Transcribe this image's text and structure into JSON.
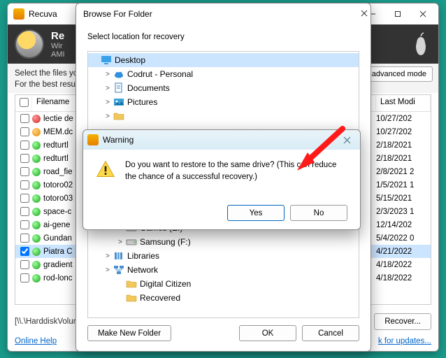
{
  "main": {
    "title": "Recuva",
    "heading_prefix": "Re",
    "sub1": "Wir",
    "sub2": "AMI",
    "instructions1": "Select the files you",
    "instructions2": "For the best results",
    "switch_mode": "to advanced mode",
    "path": "[\\\\.\\HarddiskVolume",
    "recover": "Recover...",
    "online_help": "Online Help",
    "check_updates": "k for updates...",
    "columns": {
      "filename": "Filename",
      "last_modified": "Last Modi"
    },
    "files": [
      {
        "name": "lectie de",
        "date": "10/27/202",
        "color": "r",
        "checked": false
      },
      {
        "name": "MEM.dc",
        "date": "10/27/202",
        "color": "o",
        "checked": false
      },
      {
        "name": "redturtl",
        "date": "2/18/2021",
        "color": "g",
        "checked": false
      },
      {
        "name": "redturtl",
        "date": "2/18/2021",
        "color": "g",
        "checked": false
      },
      {
        "name": "road_fie",
        "date": "2/8/2021 2",
        "color": "g",
        "checked": false
      },
      {
        "name": "totoro02",
        "date": "1/5/2021 1",
        "color": "g",
        "checked": false
      },
      {
        "name": "totoro03",
        "date": "5/15/2021",
        "color": "g",
        "checked": false
      },
      {
        "name": "space-c",
        "date": "2/3/2023 1",
        "color": "g",
        "checked": false
      },
      {
        "name": "ai-gene",
        "date": "12/14/202",
        "color": "g",
        "checked": false
      },
      {
        "name": "Gundan",
        "date": "5/4/2022 0",
        "color": "g",
        "checked": false
      },
      {
        "name": "Piatra C",
        "date": "4/21/2022",
        "color": "g",
        "checked": true
      },
      {
        "name": "gradient",
        "date": "4/18/2022",
        "color": "g",
        "checked": false
      },
      {
        "name": "rod-lonc",
        "date": "4/18/2022",
        "color": "g",
        "checked": false
      }
    ]
  },
  "browse": {
    "title": "Browse For Folder",
    "prompt": "Select location for recovery",
    "make_folder": "Make New Folder",
    "ok": "OK",
    "cancel": "Cancel",
    "tree": [
      {
        "depth": 0,
        "exp": "",
        "icon": "desktop",
        "label": "Desktop",
        "sel": true
      },
      {
        "depth": 1,
        "exp": ">",
        "icon": "cloud",
        "label": "Codrut - Personal"
      },
      {
        "depth": 1,
        "exp": ">",
        "icon": "doc",
        "label": "Documents"
      },
      {
        "depth": 1,
        "exp": ">",
        "icon": "pic",
        "label": "Pictures"
      },
      {
        "depth": 1,
        "exp": ">",
        "icon": "folder",
        "label": ""
      },
      {
        "depth": 2,
        "exp": ">",
        "icon": "drive",
        "label": "Games (E:)"
      },
      {
        "depth": 2,
        "exp": ">",
        "icon": "drive",
        "label": "Samsung (F:)"
      },
      {
        "depth": 1,
        "exp": ">",
        "icon": "lib",
        "label": "Libraries"
      },
      {
        "depth": 1,
        "exp": ">",
        "icon": "net",
        "label": "Network"
      },
      {
        "depth": 2,
        "exp": "",
        "icon": "folder",
        "label": "Digital Citizen"
      },
      {
        "depth": 2,
        "exp": "",
        "icon": "folder",
        "label": "Recovered"
      }
    ]
  },
  "warning": {
    "title": "Warning",
    "message": "Do you want to restore to the same drive? (This can reduce the chance of a successful recovery.)",
    "yes": "Yes",
    "no": "No"
  }
}
